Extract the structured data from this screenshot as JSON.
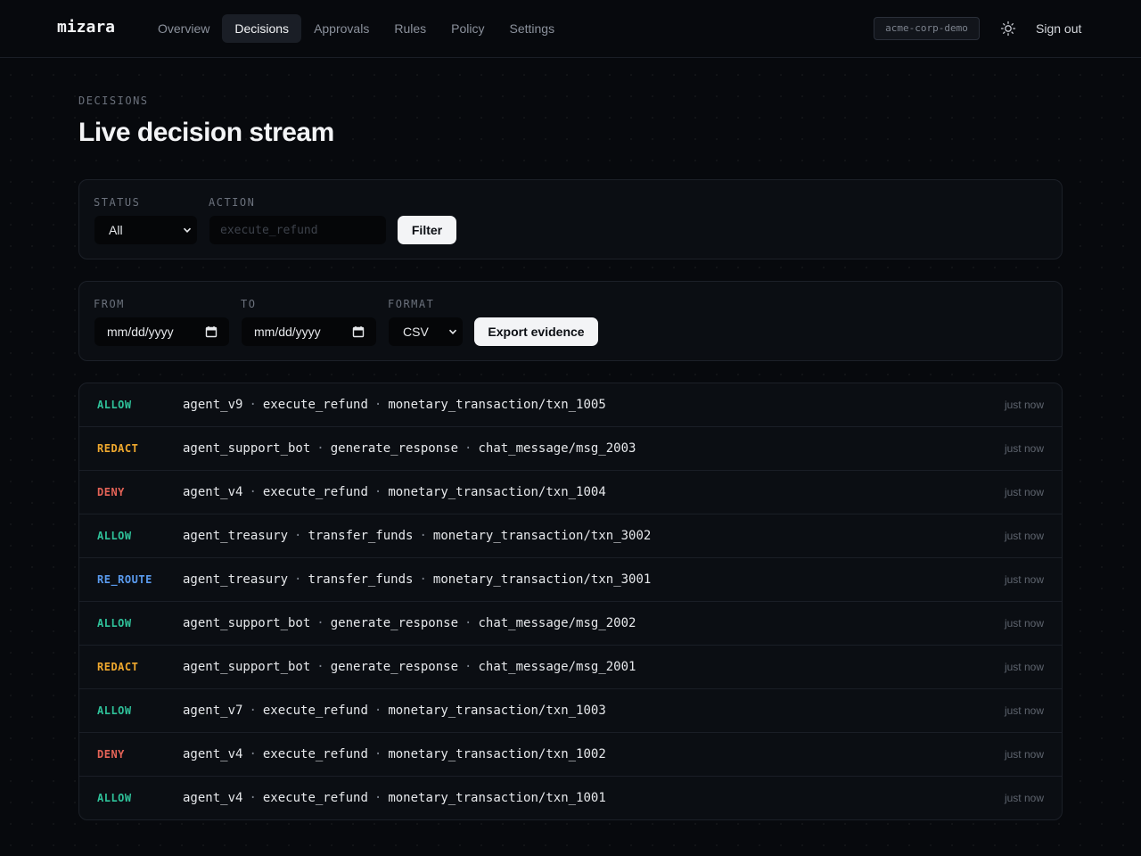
{
  "app": {
    "logo": "mizara"
  },
  "nav": {
    "items": [
      {
        "label": "Overview",
        "active": false
      },
      {
        "label": "Decisions",
        "active": true
      },
      {
        "label": "Approvals",
        "active": false
      },
      {
        "label": "Rules",
        "active": false
      },
      {
        "label": "Policy",
        "active": false
      },
      {
        "label": "Settings",
        "active": false
      }
    ],
    "tenant": "acme-corp-demo",
    "theme_icon": "sun-icon",
    "signout_label": "Sign out"
  },
  "page": {
    "eyebrow": "DECISIONS",
    "title": "Live decision stream"
  },
  "filters": {
    "status_label": "STATUS",
    "status_value": "All",
    "action_label": "ACTION",
    "action_placeholder": "execute_refund",
    "filter_button": "Filter"
  },
  "export": {
    "from_label": "FROM",
    "from_placeholder": "mm/dd/yyyy",
    "to_label": "TO",
    "to_placeholder": "mm/dd/yyyy",
    "format_label": "FORMAT",
    "format_value": "CSV",
    "export_button": "Export evidence"
  },
  "colors": {
    "ALLOW": "#2fc29a",
    "REDACT": "#f0a92e",
    "DENY": "#e56357",
    "RE_ROUTE": "#5b9cf0"
  },
  "decisions": [
    {
      "verdict": "ALLOW",
      "agent": "agent_v9",
      "action": "execute_refund",
      "resource": "monetary_transaction/txn_1005",
      "time": "just now"
    },
    {
      "verdict": "REDACT",
      "agent": "agent_support_bot",
      "action": "generate_response",
      "resource": "chat_message/msg_2003",
      "time": "just now"
    },
    {
      "verdict": "DENY",
      "agent": "agent_v4",
      "action": "execute_refund",
      "resource": "monetary_transaction/txn_1004",
      "time": "just now"
    },
    {
      "verdict": "ALLOW",
      "agent": "agent_treasury",
      "action": "transfer_funds",
      "resource": "monetary_transaction/txn_3002",
      "time": "just now"
    },
    {
      "verdict": "RE_ROUTE",
      "agent": "agent_treasury",
      "action": "transfer_funds",
      "resource": "monetary_transaction/txn_3001",
      "time": "just now"
    },
    {
      "verdict": "ALLOW",
      "agent": "agent_support_bot",
      "action": "generate_response",
      "resource": "chat_message/msg_2002",
      "time": "just now"
    },
    {
      "verdict": "REDACT",
      "agent": "agent_support_bot",
      "action": "generate_response",
      "resource": "chat_message/msg_2001",
      "time": "just now"
    },
    {
      "verdict": "ALLOW",
      "agent": "agent_v7",
      "action": "execute_refund",
      "resource": "monetary_transaction/txn_1003",
      "time": "just now"
    },
    {
      "verdict": "DENY",
      "agent": "agent_v4",
      "action": "execute_refund",
      "resource": "monetary_transaction/txn_1002",
      "time": "just now"
    },
    {
      "verdict": "ALLOW",
      "agent": "agent_v4",
      "action": "execute_refund",
      "resource": "monetary_transaction/txn_1001",
      "time": "just now"
    }
  ]
}
